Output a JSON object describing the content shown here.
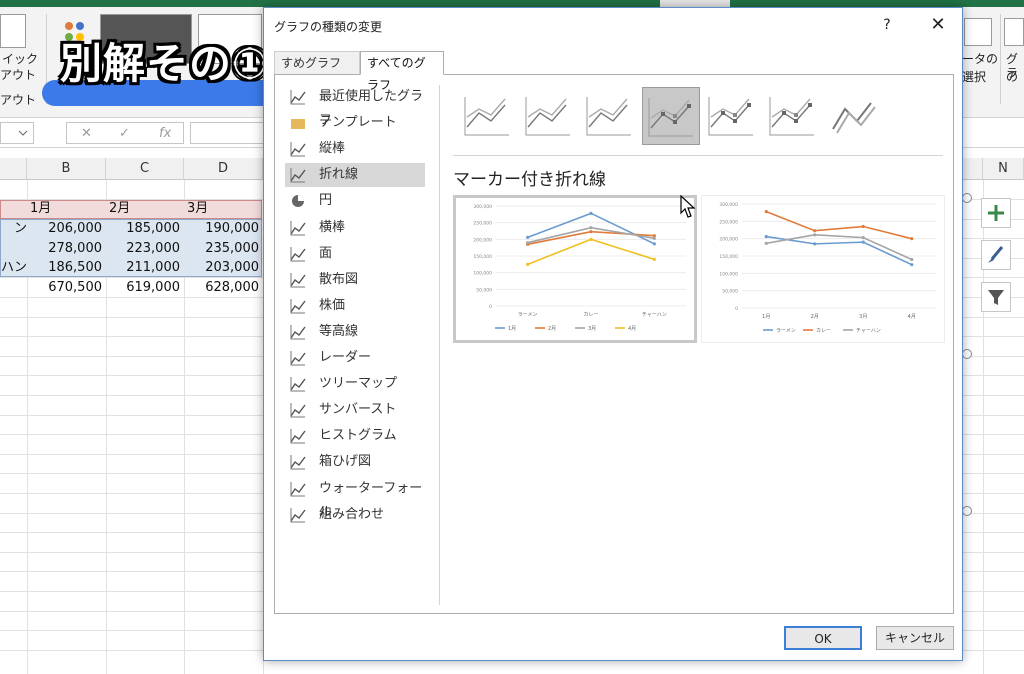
{
  "overlay": {
    "title": "別解その①"
  },
  "ribbon": {
    "left_label_1": "イック",
    "left_label_2": "アウト",
    "left_label_3": "アウト",
    "right_label_1": "ータの",
    "right_label_2": "選択",
    "right_label_3": "グラ",
    "right_label_4": "の"
  },
  "formula_bar": {
    "fx": "fx",
    "cancel": "✕",
    "enter": "✓"
  },
  "columns": [
    "B",
    "C",
    "D",
    "N"
  ],
  "sheet": {
    "headers": [
      "1月",
      "2月",
      "3月"
    ],
    "rows": [
      {
        "label": "ン",
        "values": [
          "206,000",
          "185,000",
          "190,000"
        ]
      },
      {
        "label": "",
        "values": [
          "278,000",
          "223,000",
          "235,000"
        ]
      },
      {
        "label": "ハン",
        "values": [
          "186,500",
          "211,000",
          "203,000"
        ]
      },
      {
        "label": "",
        "values": [
          "670,500",
          "619,000",
          "628,000"
        ]
      }
    ]
  },
  "dialog": {
    "title": "グラフの種類の変更",
    "help": "?",
    "close": "✕",
    "tabs": [
      "すめグラフ",
      "すべてのグラフ"
    ],
    "categories": [
      "最近使用したグラフ",
      "テンプレート",
      "縦棒",
      "折れ線",
      "円",
      "横棒",
      "面",
      "散布図",
      "株価",
      "等高線",
      "レーダー",
      "ツリーマップ",
      "サンバースト",
      "ヒストグラム",
      "箱ひげ図",
      "ウォーターフォール",
      "組み合わせ"
    ],
    "selected_category": "折れ線",
    "subtype_heading": "マーカー付き折れ線",
    "ok": "OK",
    "cancel": "キャンセル"
  },
  "preview1": {
    "yticks": [
      "300,000",
      "250,000",
      "200,000",
      "150,000",
      "100,000",
      "50,000",
      "0"
    ],
    "categories": [
      "ラーメン",
      "カレー",
      "チャーハン"
    ],
    "series": [
      {
        "name": "1月",
        "color": "#6b9bd1",
        "values": [
          206000,
          278000,
          186500
        ]
      },
      {
        "name": "2月",
        "color": "#e07b39",
        "values": [
          185000,
          223000,
          211000
        ]
      },
      {
        "name": "3月",
        "color": "#a5a5a5",
        "values": [
          190000,
          235000,
          203000
        ]
      },
      {
        "name": "4月",
        "color": "#f0c020",
        "values": [
          125000,
          200000,
          140000
        ]
      }
    ]
  },
  "preview2": {
    "yticks": [
      "300,000",
      "250,000",
      "200,000",
      "150,000",
      "100,000",
      "50,000",
      "0"
    ],
    "categories": [
      "1月",
      "2月",
      "3月",
      "4月"
    ],
    "series": [
      {
        "name": "ラーメン",
        "color": "#6b9bd1",
        "values": [
          206000,
          185000,
          190000,
          125000
        ]
      },
      {
        "name": "カレー",
        "color": "#e07b39",
        "values": [
          278000,
          223000,
          235000,
          200000
        ]
      },
      {
        "name": "チャーハン",
        "color": "#a5a5a5",
        "values": [
          186500,
          211000,
          203000,
          140000
        ]
      }
    ]
  }
}
